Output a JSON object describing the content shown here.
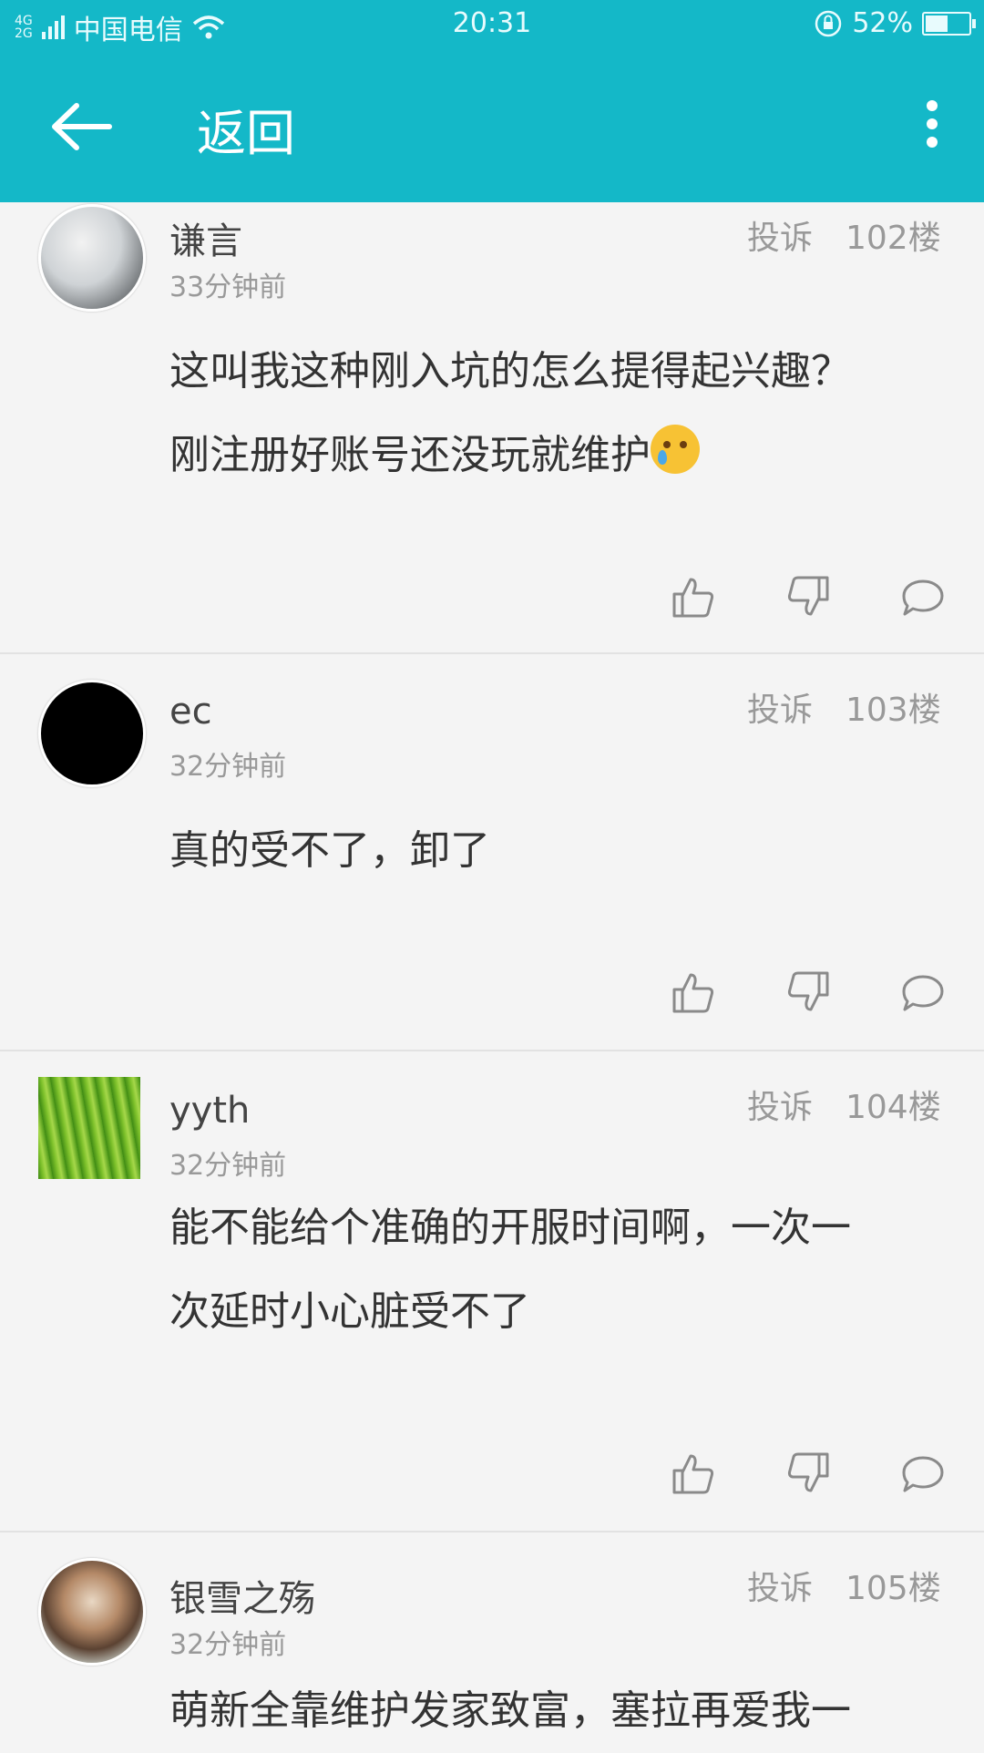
{
  "status": {
    "network": "4G 2G",
    "carrier": "中国电信",
    "time": "20:31",
    "battery": "52%",
    "battery_level": 0.52
  },
  "appbar": {
    "title": "返回"
  },
  "comments": [
    {
      "username": "谦言",
      "time": "33分钟前",
      "report": "投诉",
      "floor": "102楼",
      "text_lines": [
        "这叫我这种刚入坑的怎么提得起兴趣？",
        "刚注册好账号还没玩就维护"
      ]
    },
    {
      "username": "ec",
      "time": "32分钟前",
      "report": "投诉",
      "floor": "103楼",
      "text_lines": [
        "真的受不了，卸了"
      ]
    },
    {
      "username": "yyth",
      "time": "32分钟前",
      "report": "投诉",
      "floor": "104楼",
      "text_lines": [
        "能不能给个准确的开服时间啊，一次一",
        "次延时小心脏受不了"
      ]
    },
    {
      "username": "银雪之殇",
      "time": "32分钟前",
      "report": "投诉",
      "floor": "105楼",
      "text_lines": [
        "萌新全靠维护发家致富，塞拉再爱我一"
      ]
    }
  ],
  "colors": {
    "accent": "#14b8c8",
    "background": "#f4f4f4"
  },
  "icons": [
    "back-arrow-icon",
    "more-vert-icon",
    "thumb-up-icon",
    "thumb-down-icon",
    "comment-bubble-icon",
    "crying-emoji-icon"
  ]
}
